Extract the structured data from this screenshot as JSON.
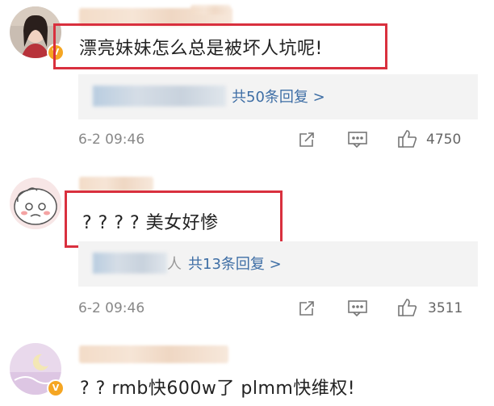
{
  "comments": [
    {
      "text": "漂亮妹妹怎么总是被坏人坑呢!",
      "reply_text": "共50条回复 >",
      "time": "6-2 09:46",
      "likes": "4750"
    },
    {
      "text": "? ? ? ? 美女好惨",
      "reply_text": "共13条回复 >",
      "time": "6-2 09:46",
      "likes": "3511"
    },
    {
      "text": "? ? rmb快600w了 plmm快维权!"
    }
  ],
  "colors": {
    "highlight": "#d9303e",
    "link": "#3e6ea5",
    "badge": "#f5a623"
  },
  "icons": [
    "share-icon",
    "comment-icon",
    "like-icon",
    "verified-badge-icon"
  ]
}
